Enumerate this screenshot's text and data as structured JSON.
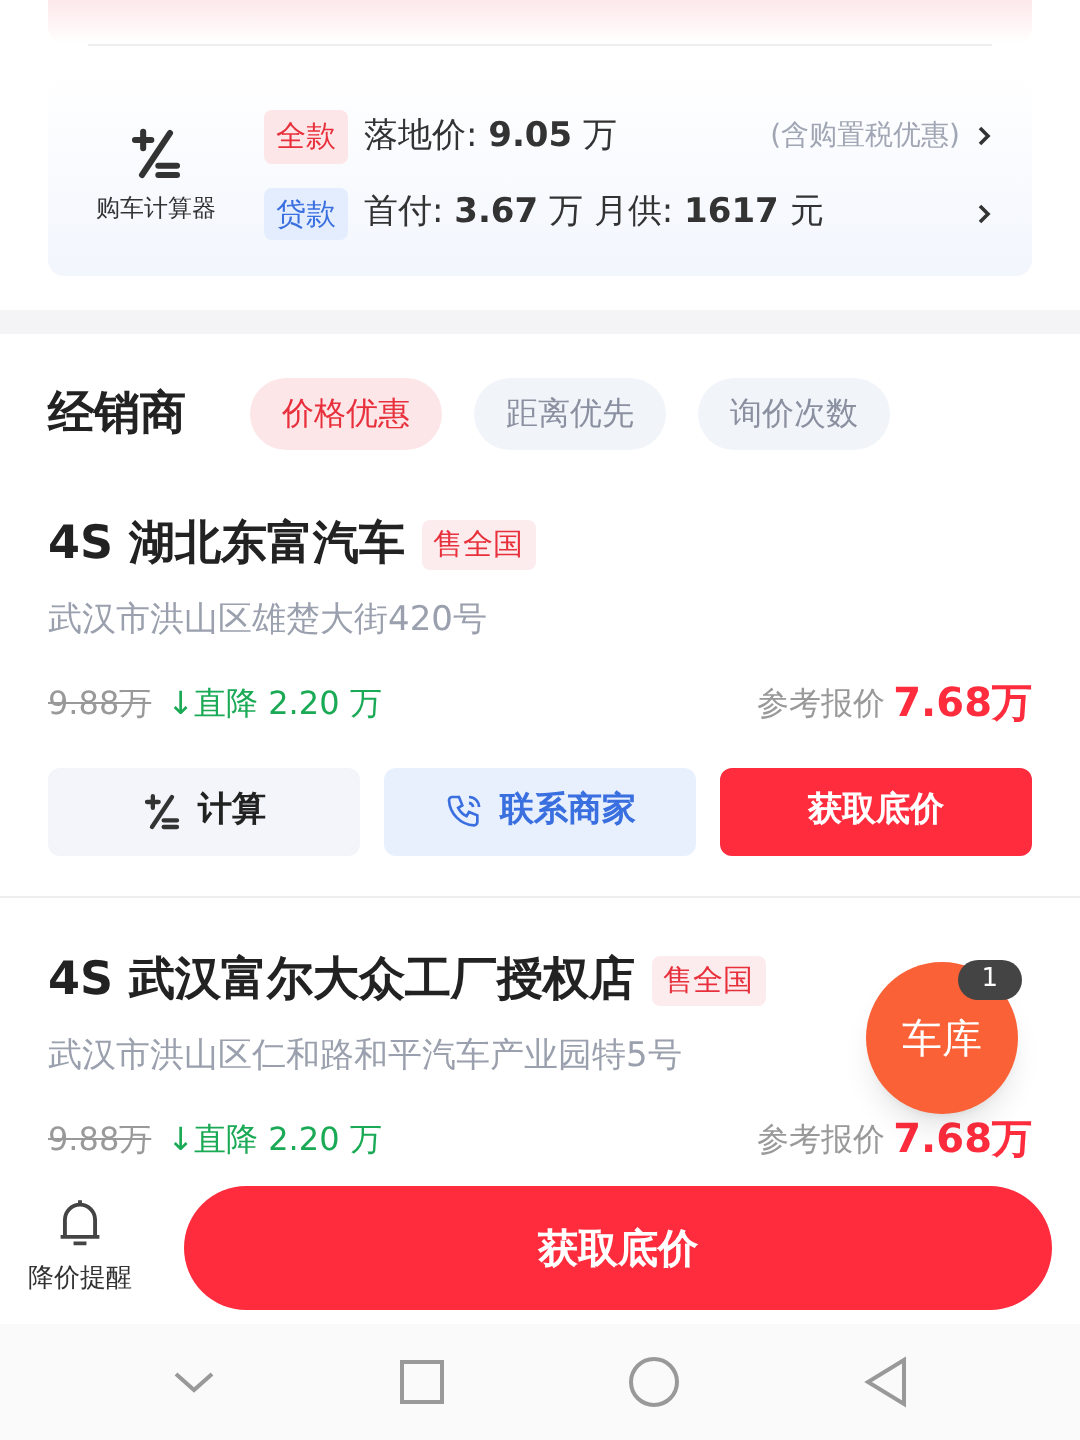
{
  "calculator": {
    "label": "购车计算器",
    "rows": [
      {
        "kind": "full",
        "tag": "全款",
        "text": "落地价: **9.05** 万",
        "note": "(含购置税优惠)"
      },
      {
        "kind": "loan",
        "tag": "贷款",
        "text": "首付: **3.67** 万 月供: **1617** 元"
      }
    ]
  },
  "dealers_header": {
    "title": "经销商",
    "sorts": [
      {
        "label": "价格优惠",
        "selected": true
      },
      {
        "label": "距离优先",
        "selected": false
      },
      {
        "label": "询价次数",
        "selected": false
      }
    ]
  },
  "dealers": [
    {
      "name": "4S 湖北东富汽车",
      "badge": "售全国",
      "address": "武汉市洪山区雄楚大街420号",
      "original_price": "9.88万",
      "drop": "↓直降 2.20 万",
      "price_label": "参考报价",
      "price": "7.68万",
      "buttons": [
        {
          "kind": "calc",
          "label": "计算"
        },
        {
          "kind": "contact",
          "label": "联系商家"
        },
        {
          "kind": "primary",
          "label": "获取底价"
        }
      ]
    },
    {
      "name": "4S 武汉富尔大众工厂授权店",
      "badge": "售全国",
      "address": "武汉市洪山区仁和路和平汽车产业园特5号",
      "original_price": "9.88万",
      "drop": "↓直降 2.20 万",
      "price_label": "参考报价",
      "price": "7.68万"
    }
  ],
  "garage_button": {
    "label": "车库",
    "count": "1"
  },
  "bottom_bar": {
    "alert_label": "降价提醒",
    "cta": "获取底价"
  }
}
